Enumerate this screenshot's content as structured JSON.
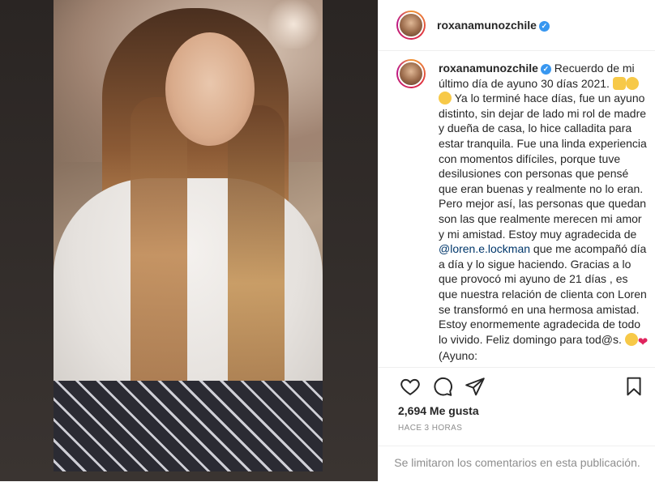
{
  "post": {
    "username": "roxanamunozchile",
    "caption": {
      "username": "roxanamunozchile",
      "part1": " Recuerdo de mi último día de ayuno 30 días 2021. ",
      "part2": " Ya lo terminé hace días, fue un ayuno distinto, sin dejar de lado mi rol de madre y dueña de casa, lo hice calladita para estar tranquila. Fue una linda experiencia con momentos difíciles, porque tuve desilusiones con personas que pensé que eran buenas y realmente no lo eran. Pero mejor así, las personas que quedan son las que realmente merecen mi amor y mi amistad. Estoy muy agradecida de ",
      "mention": "@loren.e.lockman",
      "part3": " que me acompañó día a día y lo sigue haciendo. Gracias a lo que provocó mi ayuno de 21 días , es que nuestra relación de clienta con Loren se transformó en una hermosa amistad. Estoy enormemente agradecida de todo lo vivido. Feliz domingo para tod@s. ",
      "part4": "(Ayuno:"
    },
    "likes": "2,694 Me gusta",
    "timestamp": "HACE 3 HORAS",
    "comments_limited": "Se limitaron los comentarios en esta publicación."
  },
  "icons": [
    "heart-icon",
    "comment-icon",
    "share-icon",
    "bookmark-icon",
    "verified-icon"
  ],
  "colors": {
    "verified": "#3897f0",
    "mention": "#00376b",
    "muted": "#8e8e8e"
  }
}
